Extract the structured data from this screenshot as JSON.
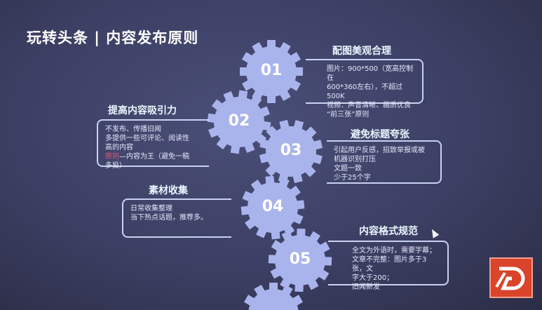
{
  "title": "玩转头条 | 内容发布原则",
  "gears": [
    {
      "label": "01"
    },
    {
      "label": "02"
    },
    {
      "label": "03"
    },
    {
      "label": "04"
    },
    {
      "label": "05"
    }
  ],
  "sections": [
    {
      "heading": "配图美观合理",
      "lines": [
        "图片：900*500（宽高控制在",
        "600*360左右），不超过500K",
        "视频：声音清晰、画质优良",
        "“前三张”原则"
      ]
    },
    {
      "heading": "提高内容吸引力",
      "lines": [
        "不发布、传播旧闻",
        "多提供一些可评论、阅读性",
        "高的内容"
      ],
      "highlight": "原则",
      "rest": "—内容为王（避免一稿多投）"
    },
    {
      "heading": "避免标题夸张",
      "lines": [
        "引起用户反感，招致举报或被",
        "机器识别打压",
        "文题一致",
        "少于25个字"
      ]
    },
    {
      "heading": "素材收集",
      "lines": [
        "日常收集整理",
        "当下热点话题，推荐多。"
      ]
    },
    {
      "heading": "内容格式规范",
      "lines": [
        "全文为外语时，需要字幕；",
        "文章不完整：图片多于3张，文",
        "字大于200；",
        "旧闻新发"
      ]
    }
  ],
  "colors": {
    "gear": "#aab4ec",
    "logo": "#d9442b",
    "background": "#3c3f63"
  }
}
